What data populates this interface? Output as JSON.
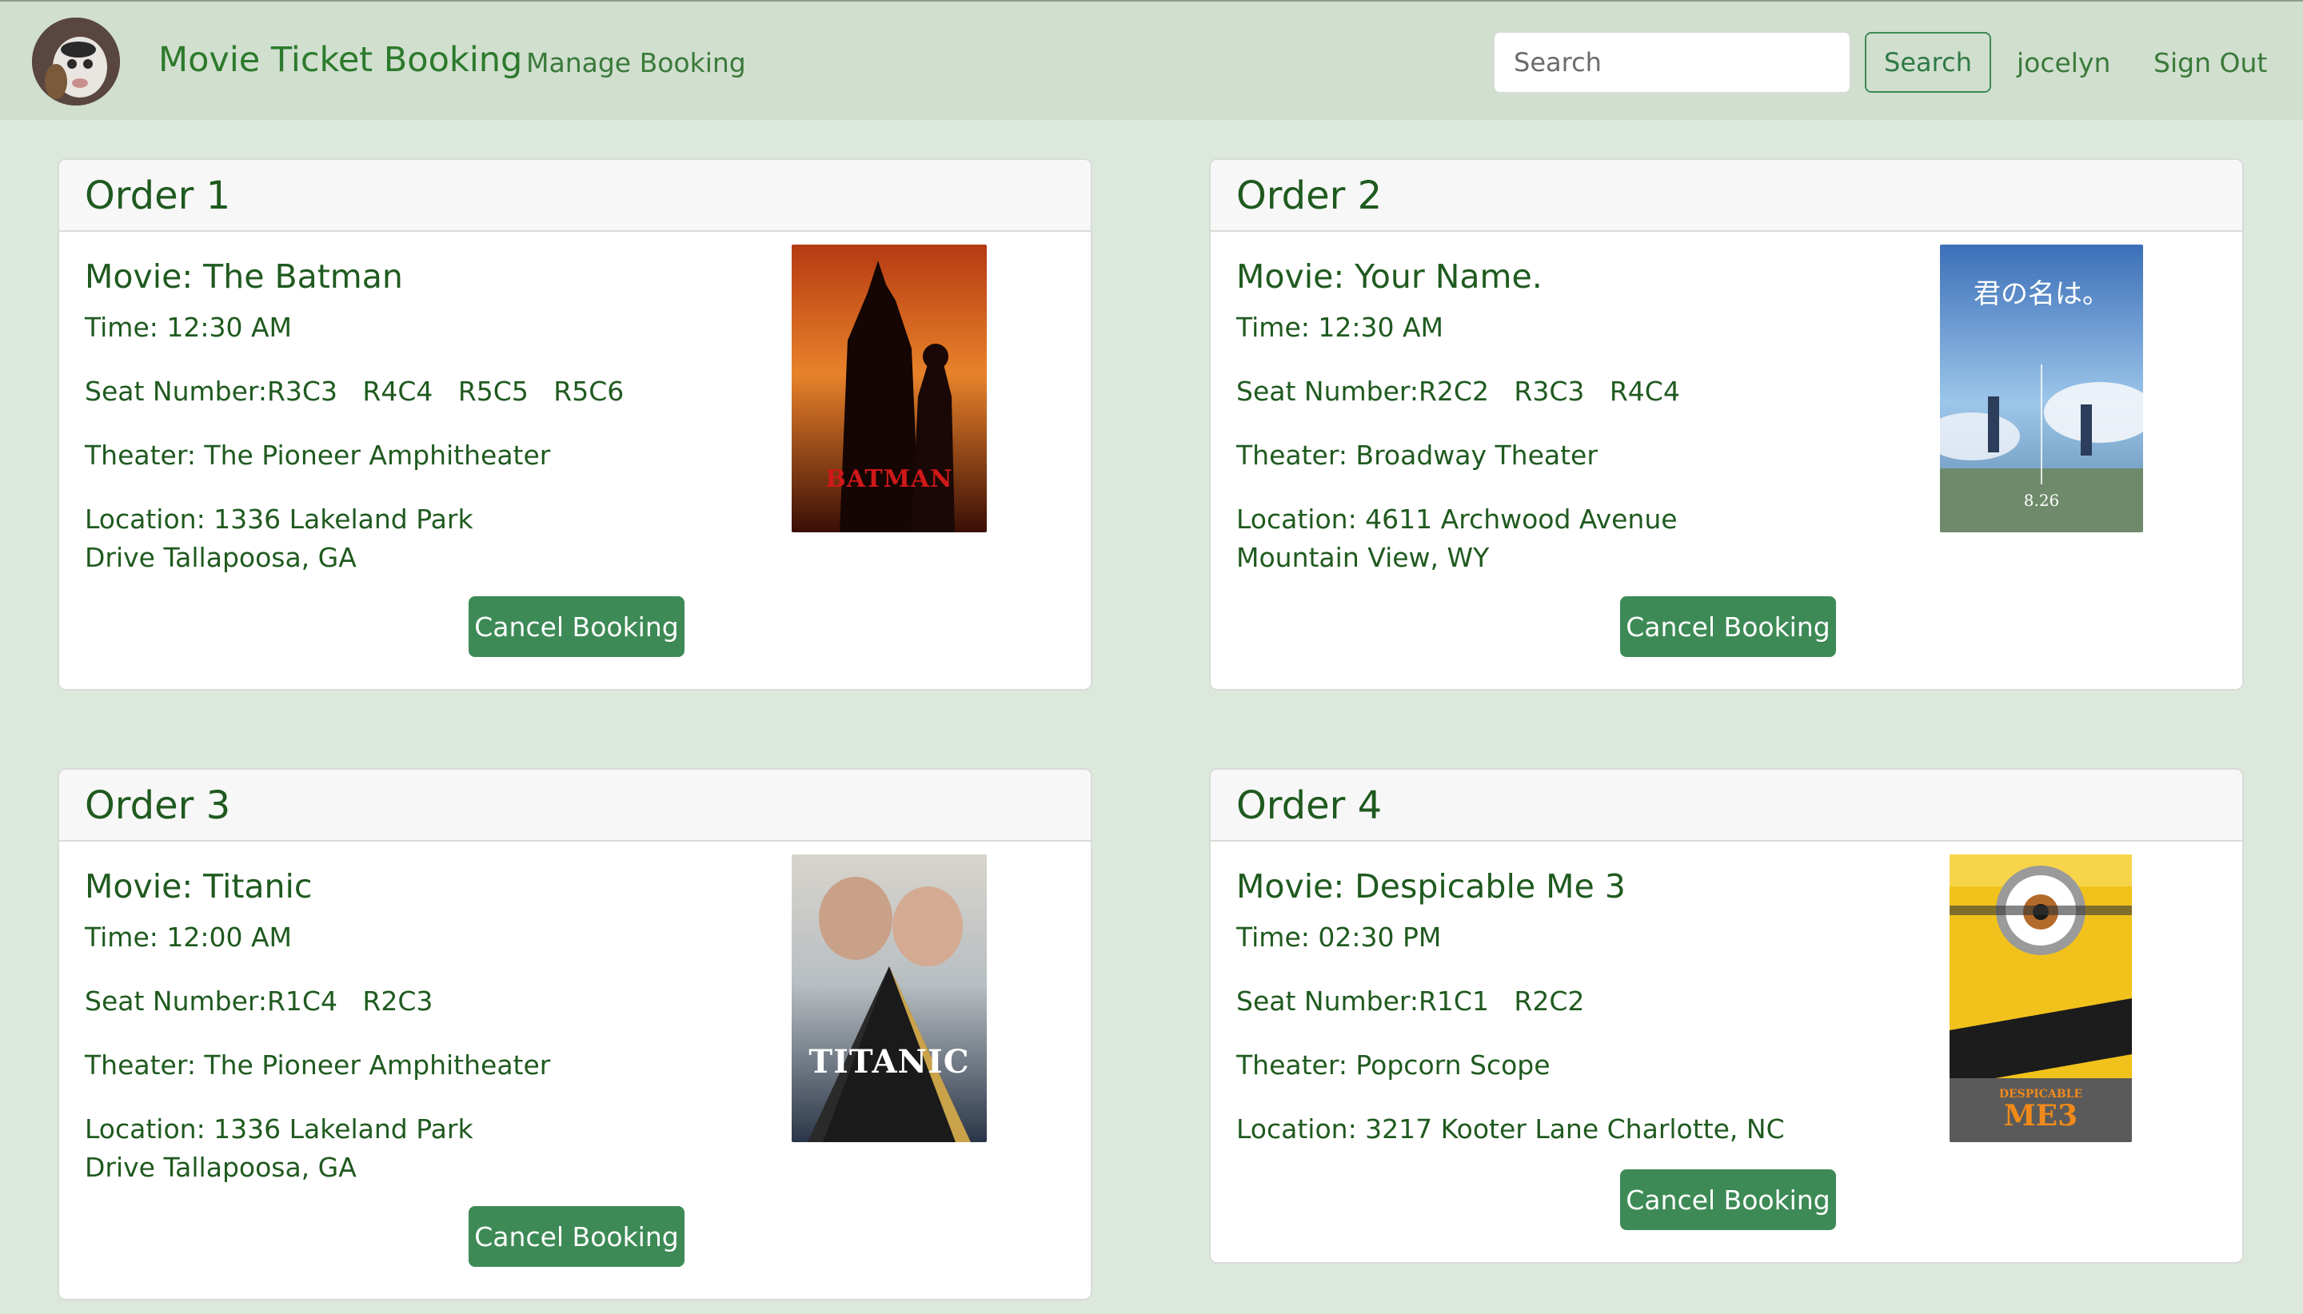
{
  "navbar": {
    "brand": "Movie Ticket Booking",
    "manage_link": "Manage Booking",
    "search_placeholder": "Search",
    "search_button": "Search",
    "username": "jocelyn",
    "signout": "Sign Out"
  },
  "orders": [
    {
      "header": "Order 1",
      "movie": "Movie: The Batman",
      "time": "Time: 12:30 AM",
      "seats": "Seat Number:R3C3   R4C4   R5C5   R5C6",
      "theater": "Theater: The Pioneer Amphitheater",
      "location": "Location: 1336 Lakeland Park Drive Tallapoosa, GA",
      "poster_icon": "batman-poster",
      "poster_text": "BATMAN",
      "cancel": "Cancel Booking"
    },
    {
      "header": "Order 2",
      "movie": "Movie: Your Name.",
      "time": "Time: 12:30 AM",
      "seats": "Seat Number:R2C2   R3C3   R4C4",
      "theater": "Theater: Broadway Theater",
      "location": "Location: 4611 Archwood Avenue Mountain View, WY",
      "poster_icon": "your-name-poster",
      "poster_text": "君の名は。",
      "poster_subtext": "8.26",
      "cancel": "Cancel Booking"
    },
    {
      "header": "Order 3",
      "movie": "Movie: Titanic",
      "time": "Time: 12:00 AM",
      "seats": "Seat Number:R1C4   R2C3",
      "theater": "Theater: The Pioneer Amphitheater",
      "location": "Location: 1336 Lakeland Park Drive Tallapoosa, GA",
      "poster_icon": "titanic-poster",
      "poster_text": "TITANIC",
      "cancel": "Cancel Booking"
    },
    {
      "header": "Order 4",
      "movie": "Movie: Despicable Me 3",
      "time": "Time: 02:30 PM",
      "seats": "Seat Number:R1C1   R2C2",
      "theater": "Theater: Popcorn Scope",
      "location": "Location: 3217 Kooter Lane Charlotte, NC",
      "poster_icon": "despicable-me-3-poster",
      "poster_text": "ME3",
      "poster_subtext": "DESPICABLE",
      "cancel": "Cancel Booking"
    }
  ],
  "colors": {
    "page_bg": "#dde8dc",
    "navbar_bg": "#d1dfcf",
    "text_green": "#1f5a1f",
    "button_green": "#3d8a56"
  }
}
